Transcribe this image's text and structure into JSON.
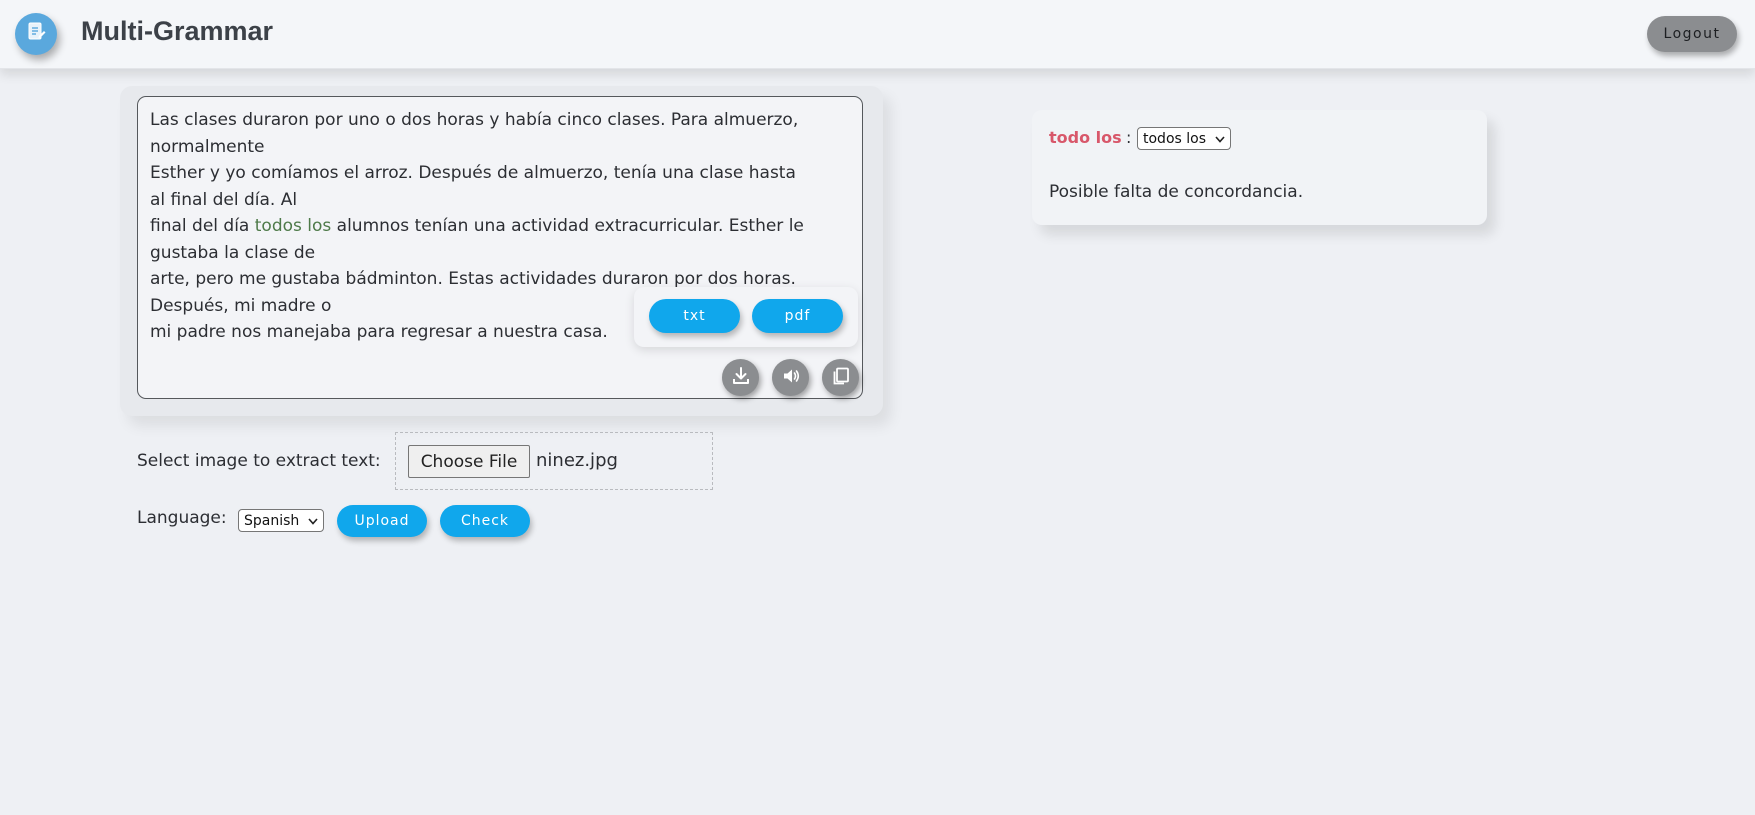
{
  "header": {
    "title": "Multi-Grammar",
    "logout_label": "Logout"
  },
  "editor": {
    "lines": [
      "Las clases duraron por uno o dos horas y había cinco clases. Para almuerzo,",
      "normalmente",
      "Esther y yo comíamos el arroz. Después de almuerzo, tenía una clase hasta",
      "al final del día. Al",
      "final del día ",
      "todos los",
      " alumnos tenían una actividad extracurricular. Esther le",
      "gustaba la clase de",
      "arte, pero me gustaba bádminton. Estas actividades duraron por dos horas.",
      "Después, mi madre o",
      "mi padre nos manejaba para regresar a nuestra casa."
    ],
    "export": {
      "txt_label": "txt",
      "pdf_label": "pdf"
    },
    "icons": [
      "download-icon",
      "speaker-icon",
      "copy-icon"
    ]
  },
  "upload": {
    "select_label": "Select image to extract text:",
    "choose_file_label": "Choose File",
    "file_name": "ninez.jpg",
    "language_label": "Language:",
    "language_selected": "Spanish",
    "upload_label": "Upload",
    "check_label": "Check"
  },
  "results": {
    "word": "todo los",
    "colon": ":",
    "suggestion_selected": "todos los",
    "message": "Posible falta de concordancia."
  },
  "colors": {
    "accent": "#10a7ec",
    "highlight_word": "#d8576a",
    "highlight_text": "#4e7a49",
    "logo": "#5aa8dd"
  }
}
